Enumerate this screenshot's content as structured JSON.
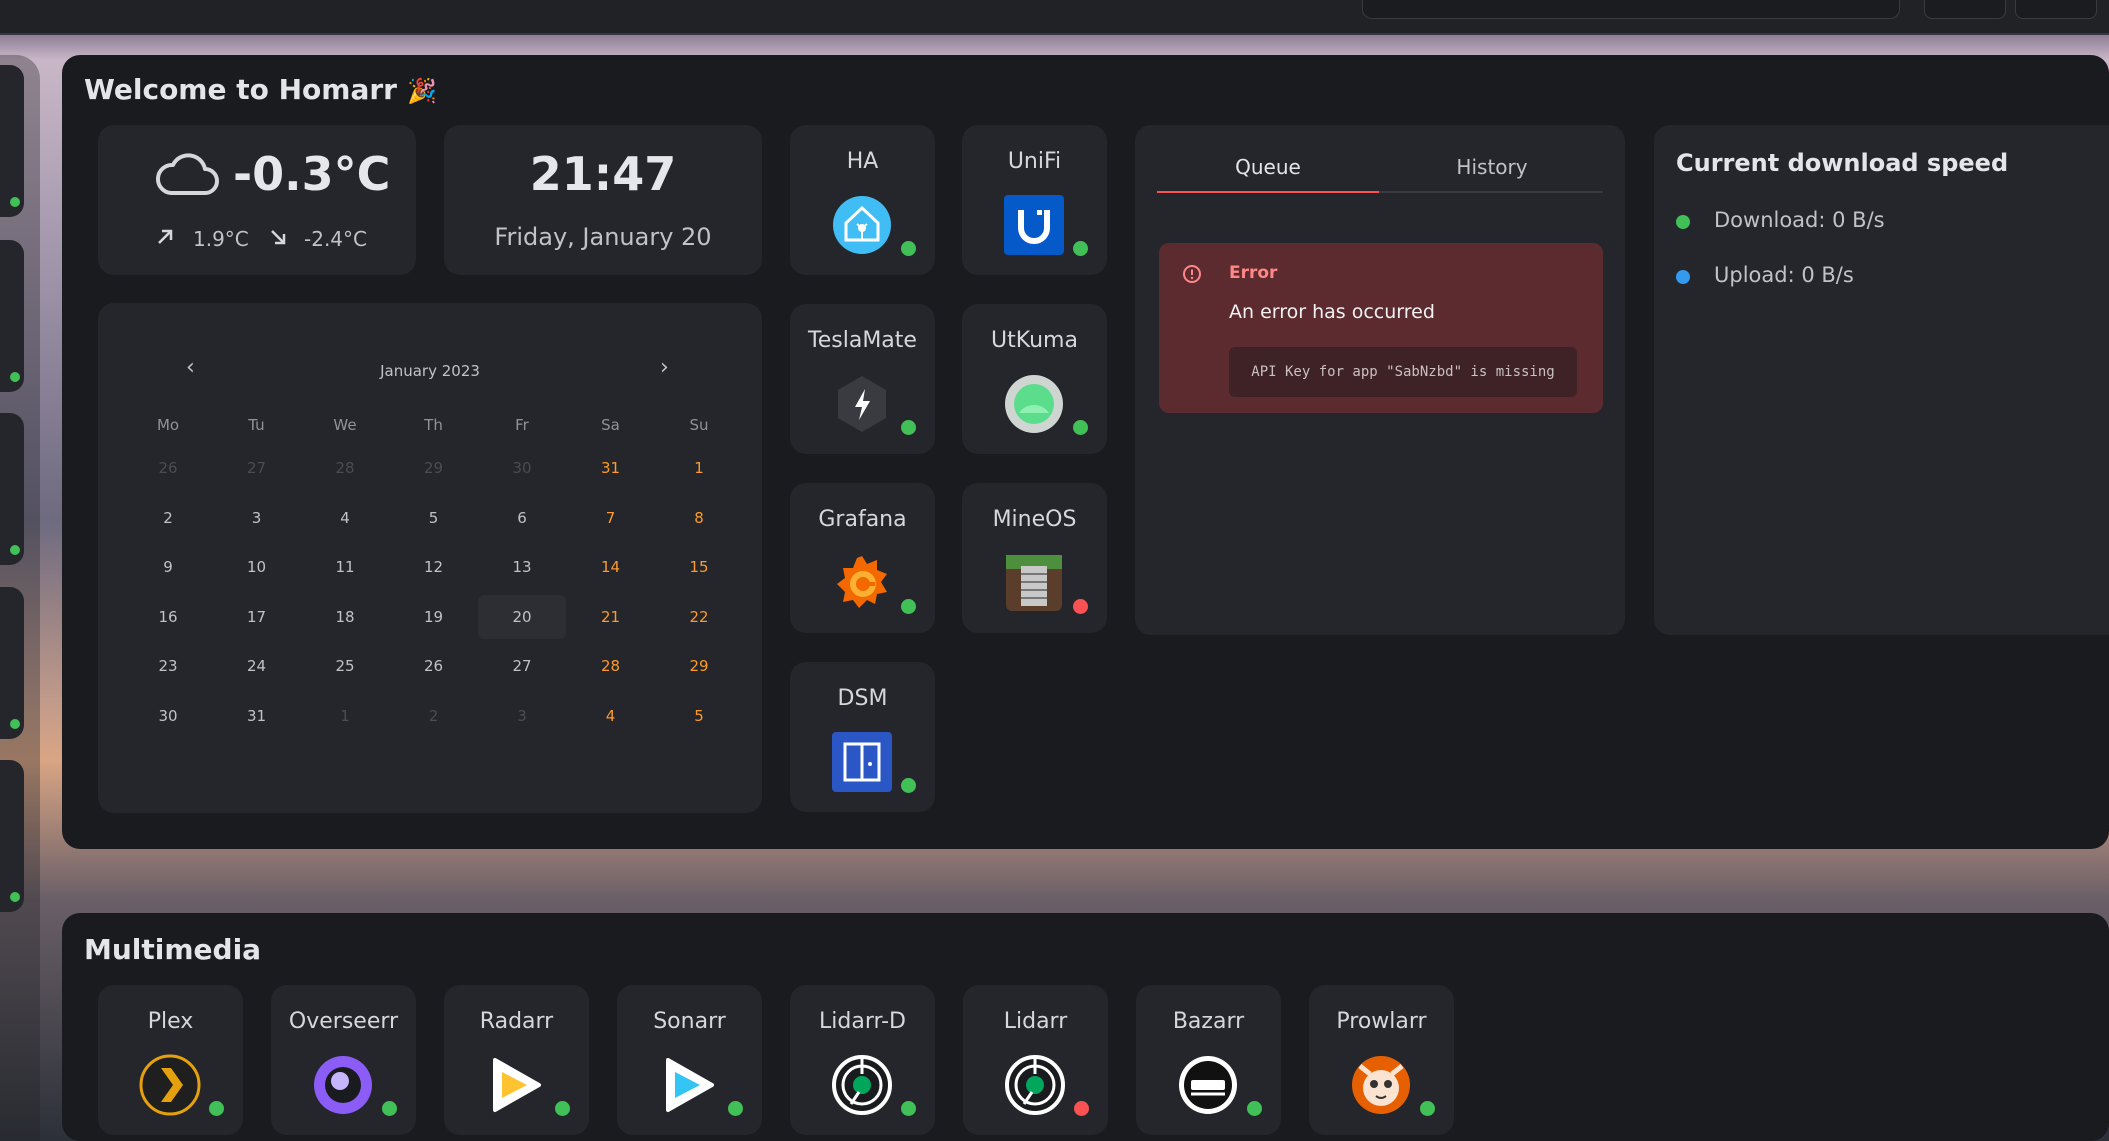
{
  "welcome": {
    "title": "Welcome to Homarr",
    "emoji": "🎉",
    "weather": {
      "temp": "-0.3°C",
      "max": "1.9°C",
      "min": "-2.4°C"
    },
    "clock": {
      "time": "21:47",
      "date": "Friday, January 20"
    },
    "calendar": {
      "month": "January 2023",
      "prev": "‹",
      "next": "›",
      "weekdays": [
        "Mo",
        "Tu",
        "We",
        "Th",
        "Fr",
        "Sa",
        "Su"
      ],
      "weeks": [
        [
          "26",
          "27",
          "28",
          "29",
          "30",
          "31",
          "1"
        ],
        [
          "2",
          "3",
          "4",
          "5",
          "6",
          "7",
          "8"
        ],
        [
          "9",
          "10",
          "11",
          "12",
          "13",
          "14",
          "15"
        ],
        [
          "16",
          "17",
          "18",
          "19",
          "20",
          "21",
          "22"
        ],
        [
          "23",
          "24",
          "25",
          "26",
          "27",
          "28",
          "29"
        ],
        [
          "30",
          "31",
          "1",
          "2",
          "3",
          "4",
          "5"
        ]
      ],
      "today": "20"
    },
    "apps": [
      {
        "name": "HA",
        "icon": "home-assistant-icon",
        "status": "online"
      },
      {
        "name": "UniFi",
        "icon": "unifi-icon",
        "status": "online"
      },
      {
        "name": "TeslaMate",
        "icon": "teslamate-icon",
        "status": "online"
      },
      {
        "name": "UtKuma",
        "icon": "uptime-kuma-icon",
        "status": "online"
      },
      {
        "name": "Grafana",
        "icon": "grafana-icon",
        "status": "online"
      },
      {
        "name": "MineOS",
        "icon": "mineos-icon",
        "status": "offline"
      },
      {
        "name": "DSM",
        "icon": "synology-dsm-icon",
        "status": "online"
      }
    ],
    "queue": {
      "tabs": [
        "Queue",
        "History"
      ],
      "error": {
        "title": "Error",
        "message": "An error has occurred",
        "code": "API Key for app \"SabNzbd\" is missing"
      }
    },
    "speed": {
      "title": "Current download speed",
      "download": "Download: 0 B/s",
      "upload": "Upload: 0 B/s",
      "download_color": "#40c057",
      "upload_color": "#339af0"
    }
  },
  "multimedia": {
    "title": "Multimedia",
    "apps": [
      {
        "name": "Plex",
        "icon": "plex-icon",
        "status": "online"
      },
      {
        "name": "Overseerr",
        "icon": "overseerr-icon",
        "status": "online"
      },
      {
        "name": "Radarr",
        "icon": "radarr-icon",
        "status": "online"
      },
      {
        "name": "Sonarr",
        "icon": "sonarr-icon",
        "status": "online"
      },
      {
        "name": "Lidarr-D",
        "icon": "lidarr-icon",
        "status": "online"
      },
      {
        "name": "Lidarr",
        "icon": "lidarr-icon",
        "status": "offline"
      },
      {
        "name": "Bazarr",
        "icon": "bazarr-icon",
        "status": "online"
      },
      {
        "name": "Prowlarr",
        "icon": "prowlarr-icon",
        "status": "online"
      }
    ]
  },
  "colors": {
    "accent_error": "#fa5252",
    "online": "#40c057",
    "weekend": "#fd9a29"
  }
}
